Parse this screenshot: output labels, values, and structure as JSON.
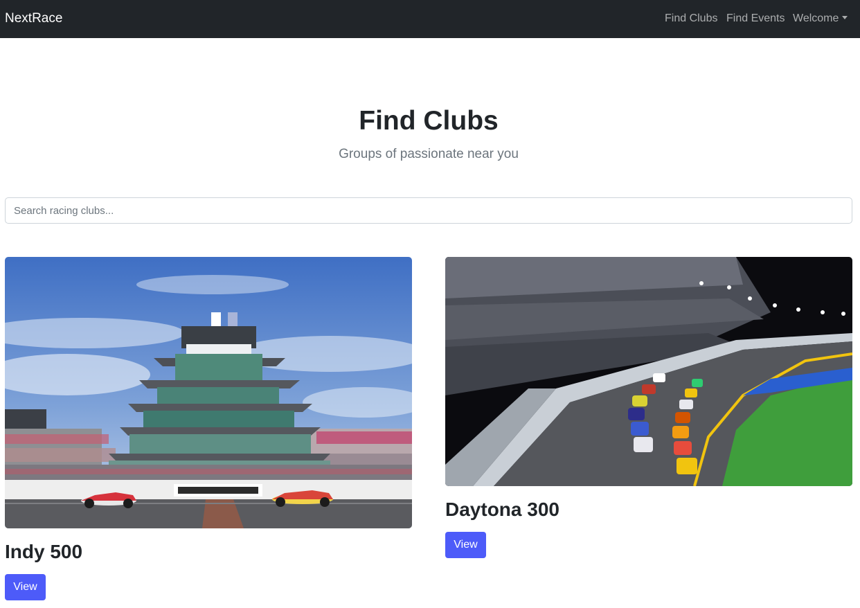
{
  "navbar": {
    "brand": "NextRace",
    "links": [
      "Find Clubs",
      "Find Events"
    ],
    "dropdown_label": "Welcome"
  },
  "hero": {
    "title": "Find Clubs",
    "subtitle": "Groups of passionate near you"
  },
  "search": {
    "placeholder": "Search racing clubs...",
    "value": ""
  },
  "clubs": [
    {
      "title": "Indy 500",
      "button_label": "View",
      "image_icon": "indianapolis-pagoda-photo"
    },
    {
      "title": "Daytona 300",
      "button_label": "View",
      "image_icon": "daytona-oval-night-race-photo"
    }
  ],
  "colors": {
    "navbar_bg": "#212529",
    "button_bg": "#4d5bf9"
  }
}
